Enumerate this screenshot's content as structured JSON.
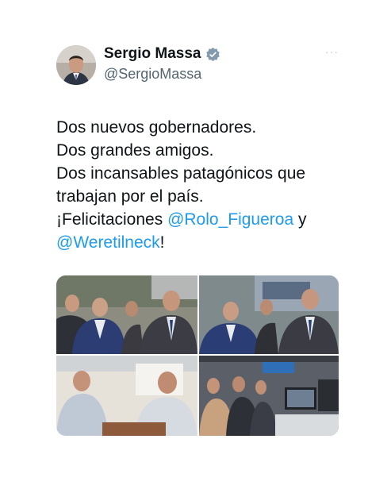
{
  "tweet": {
    "author_name": "Sergio Massa",
    "author_handle": "@SergioMassa",
    "more_label": "···",
    "text": {
      "line1": "Dos nuevos gobernadores.",
      "line2": "Dos grandes amigos.",
      "line3": "Dos incansables patagónicos que",
      "line4": "trabajan por el país.",
      "line5_prefix": "¡Felicitaciones ",
      "mention1": "@Rolo_Figueroa",
      "line5_suffix": " y",
      "mention2": "@Weretilneck",
      "line6_suffix": "!"
    },
    "media_count": 4
  },
  "colors": {
    "text": "#0f1419",
    "secondary": "#536471",
    "link": "#1d9bf0",
    "verified": "#829aab"
  },
  "icons": {
    "verified": "verified-badge-icon",
    "more": "more-options-icon"
  }
}
